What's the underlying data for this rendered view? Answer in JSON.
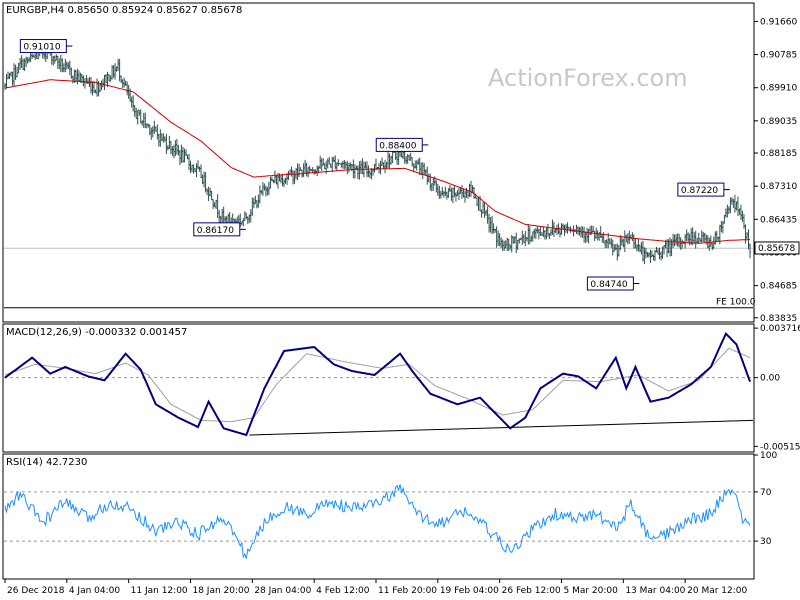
{
  "watermark": "ActionForex.com",
  "colors": {
    "candle": "#2f4f4f",
    "ma": "#cc0000",
    "macd": "#000080",
    "signal": "#a0a0a0",
    "rsi": "#1e90ff",
    "box": "#000080"
  },
  "chart_data": [
    {
      "type": "candlestick",
      "title": "EURGBP,H4  0.85650 0.85924 0.85627 0.85678",
      "ylim": [
        0.8375,
        0.9212
      ],
      "y_ticks": [
        "0.91660",
        "0.90785",
        "0.89910",
        "0.89035",
        "0.88185",
        "0.87310",
        "0.86435",
        "0.85560",
        "0.84685",
        "0.83835"
      ],
      "y_tick_values": [
        0.9166,
        0.90785,
        0.8991,
        0.89035,
        0.88185,
        0.8731,
        0.86435,
        0.8556,
        0.84685,
        0.83835
      ],
      "x_ticks": [
        "26 Dec 2018",
        "4 Jan 04:00",
        "11 Jan 12:00",
        "18 Jan 20:00",
        "28 Jan 04:00",
        "4 Feb 12:00",
        "11 Feb 20:00",
        "19 Feb 04:00",
        "26 Feb 12:00",
        "5 Mar 20:00",
        "13 Mar 04:00",
        "20 Mar 12:00"
      ],
      "x_tick_index": [
        0,
        41,
        82,
        123,
        164,
        205,
        246,
        287,
        328,
        369,
        410,
        451
      ],
      "n_bars": 495,
      "close_key": [
        [
          0,
          0.8995
        ],
        [
          10,
          0.905
        ],
        [
          28,
          0.909
        ],
        [
          40,
          0.904
        ],
        [
          60,
          0.899
        ],
        [
          75,
          0.9045
        ],
        [
          85,
          0.893
        ],
        [
          100,
          0.887
        ],
        [
          115,
          0.882
        ],
        [
          130,
          0.876
        ],
        [
          145,
          0.864
        ],
        [
          158,
          0.864
        ],
        [
          175,
          0.874
        ],
        [
          200,
          0.8775
        ],
        [
          220,
          0.8795
        ],
        [
          240,
          0.877
        ],
        [
          262,
          0.882
        ],
        [
          275,
          0.878
        ],
        [
          290,
          0.8705
        ],
        [
          310,
          0.872
        ],
        [
          320,
          0.864
        ],
        [
          330,
          0.857
        ],
        [
          350,
          0.8605
        ],
        [
          375,
          0.8625
        ],
        [
          392,
          0.86
        ],
        [
          405,
          0.856
        ],
        [
          415,
          0.86
        ],
        [
          425,
          0.854
        ],
        [
          440,
          0.857
        ],
        [
          455,
          0.86
        ],
        [
          470,
          0.858
        ],
        [
          482,
          0.87
        ],
        [
          488,
          0.865
        ],
        [
          494,
          0.8568
        ]
      ],
      "ma_key": [
        [
          0,
          0.899
        ],
        [
          30,
          0.9012
        ],
        [
          60,
          0.9005
        ],
        [
          85,
          0.898
        ],
        [
          110,
          0.89
        ],
        [
          130,
          0.885
        ],
        [
          150,
          0.878
        ],
        [
          165,
          0.8755
        ],
        [
          180,
          0.876
        ],
        [
          200,
          0.8765
        ],
        [
          230,
          0.8775
        ],
        [
          265,
          0.8778
        ],
        [
          290,
          0.8745
        ],
        [
          310,
          0.8715
        ],
        [
          325,
          0.8665
        ],
        [
          345,
          0.863
        ],
        [
          370,
          0.8617
        ],
        [
          400,
          0.8602
        ],
        [
          420,
          0.8592
        ],
        [
          440,
          0.8585
        ],
        [
          460,
          0.858
        ],
        [
          480,
          0.8588
        ],
        [
          494,
          0.859
        ]
      ],
      "current": {
        "label": "0.85678",
        "value": 0.85678
      },
      "hline": 0.8567,
      "fe_line": {
        "label": "FE 100.0",
        "value": 0.841
      },
      "annotations": [
        {
          "label": "0.91010",
          "value": 0.9101,
          "bar": 42,
          "side": "left"
        },
        {
          "label": "0.86170",
          "value": 0.8617,
          "bar": 157,
          "side": "left"
        },
        {
          "label": "0.88400",
          "value": 0.884,
          "bar": 278,
          "side": "left"
        },
        {
          "label": "0.84740",
          "value": 0.8474,
          "bar": 418,
          "side": "left"
        },
        {
          "label": "0.87220",
          "value": 0.8722,
          "bar": 478,
          "side": "left"
        }
      ]
    },
    {
      "type": "line",
      "title": "MACD(12,26,9) -0.000332 0.001457",
      "ylim": [
        -0.0055,
        0.00395
      ],
      "y_ticks": [
        "0.003716",
        "0.00",
        "-0.005152"
      ],
      "y_tick_values": [
        0.003716,
        0.0,
        -0.005152
      ],
      "zero_line": 0,
      "macd_key": [
        [
          0,
          0.0
        ],
        [
          18,
          0.0015
        ],
        [
          30,
          0.0003
        ],
        [
          40,
          0.0008
        ],
        [
          55,
          0.0001
        ],
        [
          66,
          -0.0002
        ],
        [
          80,
          0.0018
        ],
        [
          90,
          0.0006
        ],
        [
          100,
          -0.002
        ],
        [
          115,
          -0.003
        ],
        [
          128,
          -0.0037
        ],
        [
          135,
          -0.0018
        ],
        [
          145,
          -0.0038
        ],
        [
          160,
          -0.0043
        ],
        [
          172,
          -0.0008
        ],
        [
          185,
          0.002
        ],
        [
          205,
          0.0023
        ],
        [
          218,
          0.001
        ],
        [
          230,
          0.0005
        ],
        [
          245,
          0.0002
        ],
        [
          262,
          0.0018
        ],
        [
          270,
          0.0005
        ],
        [
          282,
          -0.0012
        ],
        [
          300,
          -0.002
        ],
        [
          315,
          -0.0015
        ],
        [
          335,
          -0.0038
        ],
        [
          345,
          -0.003
        ],
        [
          355,
          -0.0008
        ],
        [
          370,
          0.0003
        ],
        [
          380,
          0.0001
        ],
        [
          392,
          -0.0008
        ],
        [
          405,
          0.0015
        ],
        [
          412,
          -0.0008
        ],
        [
          418,
          0.0008
        ],
        [
          428,
          -0.0018
        ],
        [
          440,
          -0.0015
        ],
        [
          455,
          -0.0005
        ],
        [
          468,
          0.0008
        ],
        [
          478,
          0.0033
        ],
        [
          485,
          0.0025
        ],
        [
          494,
          -0.0003
        ]
      ],
      "signal_key": [
        [
          0,
          0.0002
        ],
        [
          20,
          0.001
        ],
        [
          40,
          0.0007
        ],
        [
          60,
          0.0003
        ],
        [
          80,
          0.0011
        ],
        [
          95,
          0.0002
        ],
        [
          110,
          -0.002
        ],
        [
          130,
          -0.0032
        ],
        [
          150,
          -0.0033
        ],
        [
          165,
          -0.003
        ],
        [
          180,
          -0.0005
        ],
        [
          200,
          0.0018
        ],
        [
          225,
          0.0012
        ],
        [
          250,
          0.0007
        ],
        [
          268,
          0.001
        ],
        [
          285,
          -0.0006
        ],
        [
          305,
          -0.0015
        ],
        [
          330,
          -0.0028
        ],
        [
          350,
          -0.0024
        ],
        [
          370,
          -0.0002
        ],
        [
          395,
          -0.0003
        ],
        [
          420,
          0.0002
        ],
        [
          440,
          -0.001
        ],
        [
          460,
          -0.0002
        ],
        [
          480,
          0.0022
        ],
        [
          494,
          0.0015
        ]
      ],
      "trend_line": [
        [
          162,
          -0.0043
        ],
        [
          500,
          -0.0032
        ]
      ]
    },
    {
      "type": "line",
      "title": "RSI(14) 42.7230",
      "ylim": [
        0,
        100
      ],
      "y_ticks": [
        "100",
        "70",
        "30",
        "0"
      ],
      "y_tick_values": [
        100,
        70,
        30,
        0
      ],
      "levels": [
        70,
        30
      ],
      "rsi_key": [
        [
          0,
          55
        ],
        [
          10,
          68
        ],
        [
          25,
          45
        ],
        [
          40,
          62
        ],
        [
          55,
          48
        ],
        [
          70,
          62
        ],
        [
          85,
          55
        ],
        [
          100,
          38
        ],
        [
          115,
          46
        ],
        [
          128,
          35
        ],
        [
          145,
          50
        ],
        [
          160,
          18
        ],
        [
          172,
          45
        ],
        [
          185,
          58
        ],
        [
          200,
          52
        ],
        [
          215,
          62
        ],
        [
          230,
          56
        ],
        [
          245,
          60
        ],
        [
          262,
          72
        ],
        [
          275,
          50
        ],
        [
          290,
          45
        ],
        [
          305,
          55
        ],
        [
          320,
          40
        ],
        [
          335,
          20
        ],
        [
          350,
          40
        ],
        [
          365,
          52
        ],
        [
          380,
          48
        ],
        [
          392,
          52
        ],
        [
          405,
          40
        ],
        [
          415,
          60
        ],
        [
          428,
          30
        ],
        [
          440,
          36
        ],
        [
          455,
          48
        ],
        [
          468,
          52
        ],
        [
          478,
          70
        ],
        [
          485,
          70
        ],
        [
          490,
          44
        ],
        [
          494,
          42.7
        ]
      ]
    }
  ]
}
